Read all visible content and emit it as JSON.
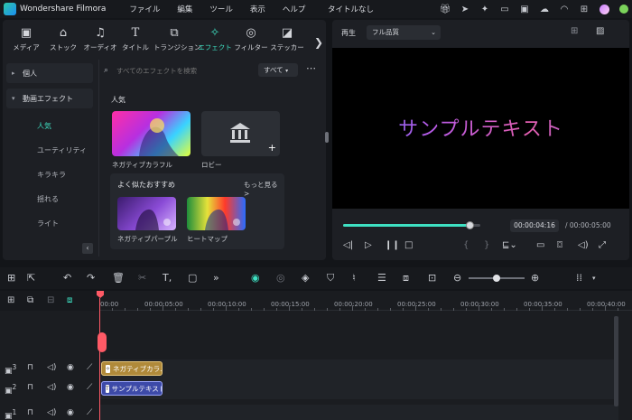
{
  "app": {
    "name": "Wondershare Filmora",
    "doc_title": "タイトルなし"
  },
  "menu": [
    "ファイル",
    "編集",
    "ツール",
    "表示",
    "ヘルプ"
  ],
  "titlebar_icons": [
    "gift-icon",
    "send-icon",
    "lightbulb-icon",
    "screen-icon",
    "save-icon",
    "cloud-upload-icon",
    "headset-icon",
    "grid-icon"
  ],
  "tabs": [
    {
      "label": "メディア",
      "icon": "media-icon"
    },
    {
      "label": "ストック",
      "icon": "stock-icon"
    },
    {
      "label": "オーディオ",
      "icon": "music-icon"
    },
    {
      "label": "タイトル",
      "icon": "title-icon"
    },
    {
      "label": "トランジション",
      "icon": "transition-icon"
    },
    {
      "label": "エフェクト",
      "icon": "effect-icon"
    },
    {
      "label": "フィルター",
      "icon": "filter-icon"
    },
    {
      "label": "ステッカー",
      "icon": "sticker-icon"
    }
  ],
  "sidebar": {
    "categories": [
      {
        "label": "個人",
        "arrow": "▸"
      },
      {
        "label": "動画エフェクト",
        "arrow": "▾"
      }
    ],
    "subitems": [
      "人気",
      "ユーティリティ",
      "キラキラ",
      "揺れる",
      "ライト"
    ]
  },
  "search": {
    "placeholder": "すべてのエフェクトを検索",
    "filter": "すべて"
  },
  "popular": {
    "title": "人気",
    "items": [
      "ネガティブカラフル",
      "ロビー"
    ]
  },
  "recommend": {
    "title": "よく似たおすすめ",
    "more": "もっと見る >",
    "items": [
      "ネガティブパープル",
      "ヒートマップ"
    ]
  },
  "preview": {
    "label": "再生",
    "quality": "フル品質",
    "overlay_text": "サンプルテキスト",
    "current_time": "00:00:04:16",
    "total_time": "/ 00:00:05:00",
    "progress": 0.92
  },
  "timeline": {
    "ruler_labels": [
      "00:00",
      "00:00:05:00",
      "00:00:10:00",
      "00:00:15:00",
      "00:00:20:00",
      "00:00:25:00",
      "00:00:30:00",
      "00:00:35:00",
      "00:00:40:00"
    ],
    "tracks": [
      {
        "number": "3",
        "clip": "ネガティブカラ..."
      },
      {
        "number": "2",
        "clip": "サンプルテキスト"
      },
      {
        "number": "1",
        "clip": ""
      }
    ],
    "zoom": 0.5
  }
}
